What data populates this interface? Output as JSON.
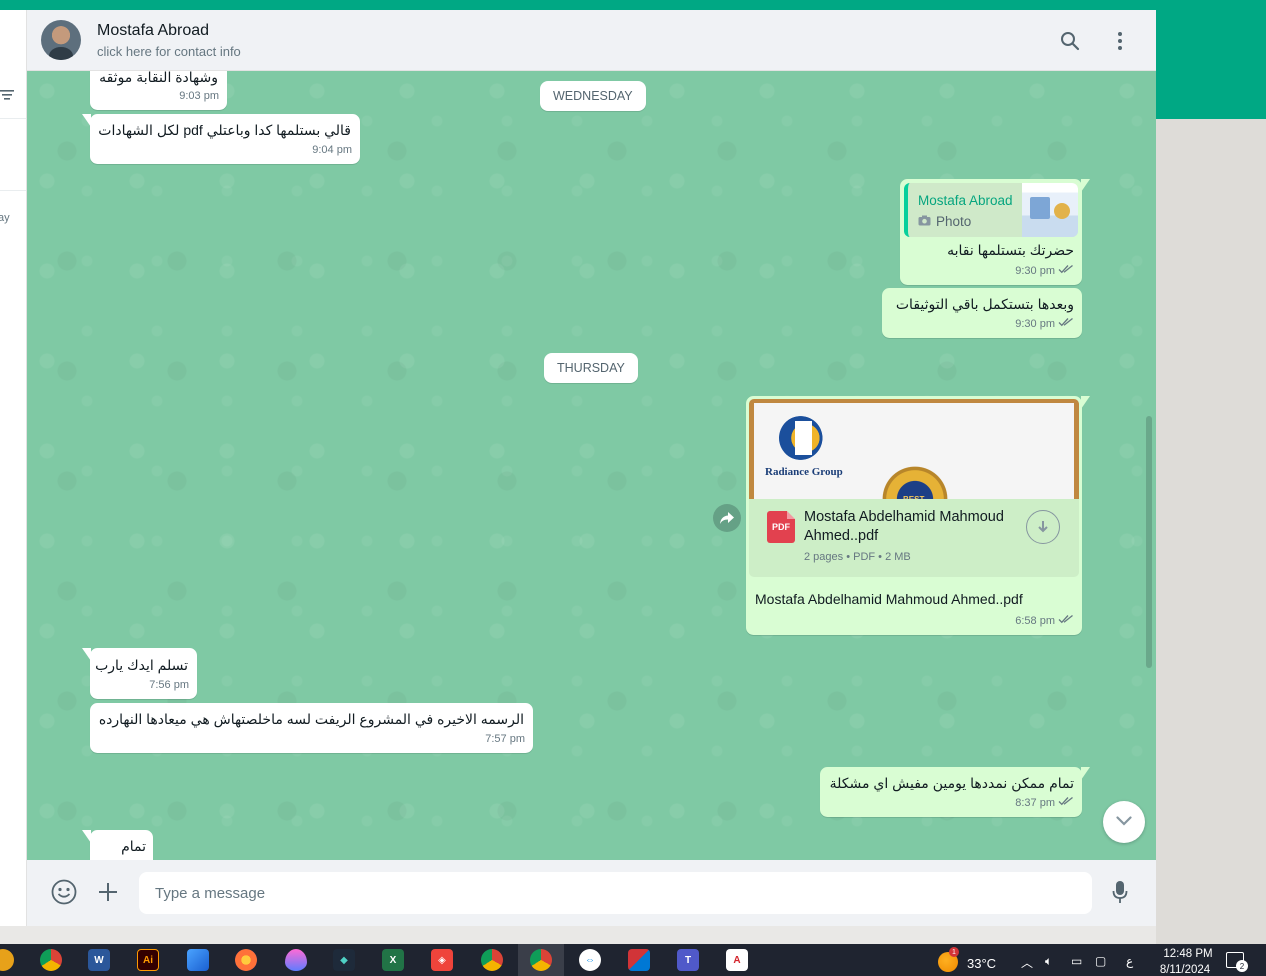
{
  "contact": {
    "name": "Mostafa Abroad",
    "subtitle": "click here for contact info"
  },
  "sidebar": {
    "fragment": "ay"
  },
  "day_labels": {
    "wednesday": "WEDNESDAY",
    "thursday": "THURSDAY"
  },
  "messages": [
    {
      "direction": "in",
      "text": "وشهادة النقابة موثقه",
      "time": "9:03 pm"
    },
    {
      "direction": "in",
      "text": "قالي بستلمها كدا وباعتلي pdf لكل الشهادات",
      "time": "9:04 pm"
    },
    {
      "direction": "out",
      "quote_name": "Mostafa Abroad",
      "quote_type": "Photo",
      "text": "حضرتك بتستلمها نقابه",
      "time": "9:30 pm"
    },
    {
      "direction": "out",
      "text": "وبعدها بتستكمل باقي التوثيقات",
      "time": "9:30 pm"
    },
    {
      "direction": "out",
      "type": "document",
      "preview_logo_text": "Radiance Group",
      "preview_badge_text": "BEST",
      "doc_name": "Mostafa Abdelhamid Mahmoud Ahmed..pdf",
      "doc_info": "2 pages • PDF • 2 MB",
      "caption": "Mostafa Abdelhamid Mahmoud Ahmed..pdf",
      "time": "6:58 pm"
    },
    {
      "direction": "in",
      "text": "تسلم ايدك يارب",
      "time": "7:56 pm"
    },
    {
      "direction": "in",
      "text": "الرسمه الاخيره في  المشروع الريفت لسه ماخلصتهاش هي ميعادها النهارده",
      "time": "7:57 pm"
    },
    {
      "direction": "out",
      "text": "تمام ممكن نمددها يومين مفيش اي مشكلة",
      "time": "8:37 pm"
    },
    {
      "direction": "in",
      "text": "تمام",
      "time": ""
    }
  ],
  "composer": {
    "placeholder": "Type a message"
  },
  "taskbar": {
    "apps": [
      "chrome",
      "word",
      "illustrator",
      "paint",
      "firefox",
      "droplet",
      "filmora",
      "excel",
      "anydesk",
      "chrome",
      "chrome",
      "teamviewer",
      "app",
      "teams",
      "acrobat"
    ],
    "temperature": "33°C",
    "language": "ع",
    "time": "12:48 PM",
    "date": "8/11/2024",
    "notification_count": "2"
  },
  "colors": {
    "brand_green": "#00a884",
    "chat_bg": "#7fc9a4",
    "outgoing_bubble": "#d9fdd3",
    "incoming_bubble": "#ffffff"
  }
}
